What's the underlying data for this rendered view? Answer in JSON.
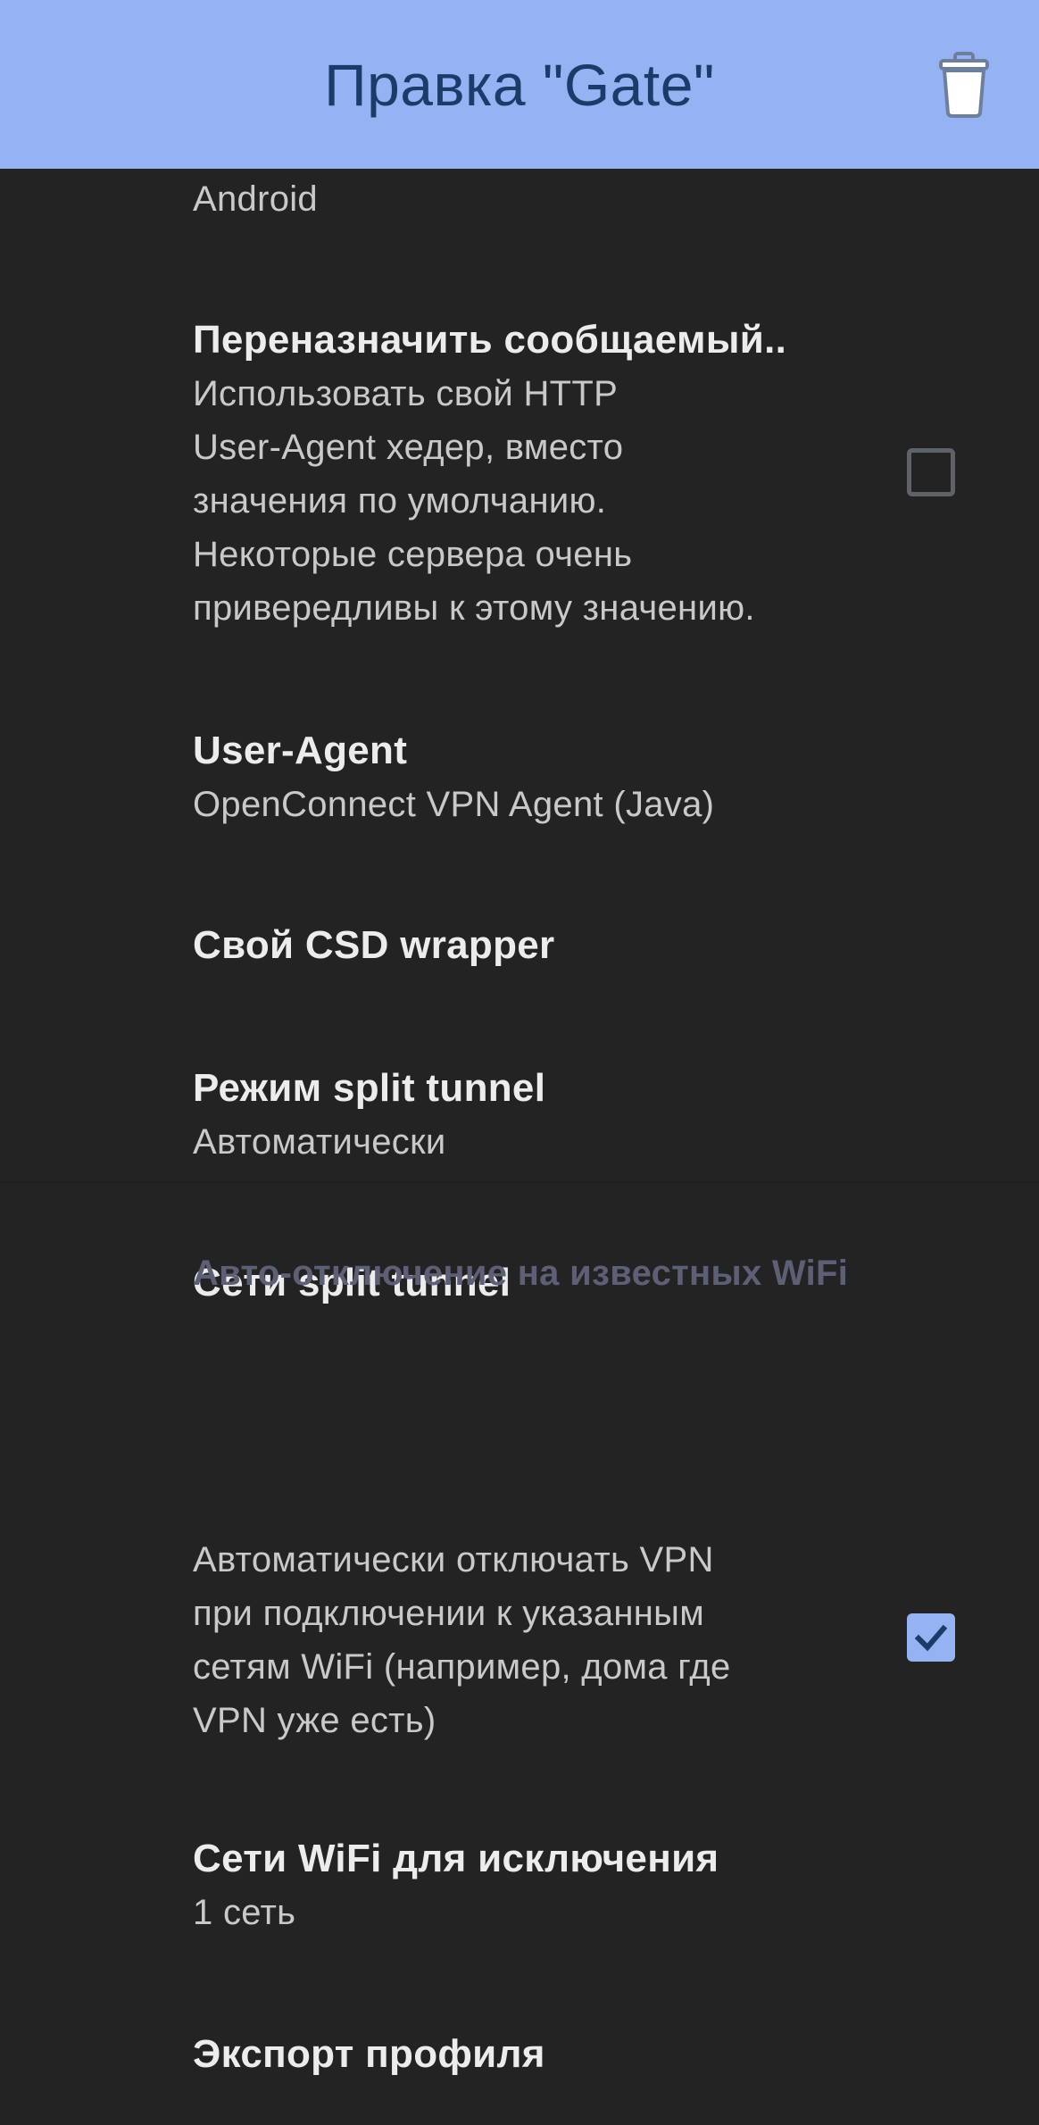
{
  "appbar": {
    "title": "Правка \"Gate\"",
    "delete_icon": "trash-icon",
    "background": "#95b2f2",
    "title_color": "#1c3b69"
  },
  "items": [
    {
      "summary": "Android"
    },
    {
      "title": "Переназначить сообщаемый..",
      "summary_lines": [
        "Использовать свой HTTP",
        "User-Agent хедер, вместо",
        "значения по умолчанию.",
        "Некоторые сервера очень",
        "привередливы к этому значению."
      ],
      "checked": false
    },
    {
      "title": "User-Agent",
      "summary": "OpenConnect VPN Agent (Java)"
    },
    {
      "title": "Свой CSD wrapper"
    },
    {
      "title": "Режим split tunnel",
      "summary": "Автоматически"
    },
    {
      "title": "Сети split tunnel"
    }
  ],
  "section": {
    "header": "Авто-отключение на известных WiFi",
    "items": [
      {
        "summary_lines": [
          "Автоматически отключать VPN",
          "при подключении к указанным",
          "сетям WiFi (например, дома где",
          "VPN уже есть)"
        ],
        "checked": true
      },
      {
        "title": "Сети WiFi для исключения",
        "summary": "1 сеть"
      },
      {
        "title": "Экспорт профиля"
      }
    ]
  },
  "colors": {
    "background": "#232323",
    "accent": "#95b2f2",
    "section_header": "#5d5f75"
  }
}
